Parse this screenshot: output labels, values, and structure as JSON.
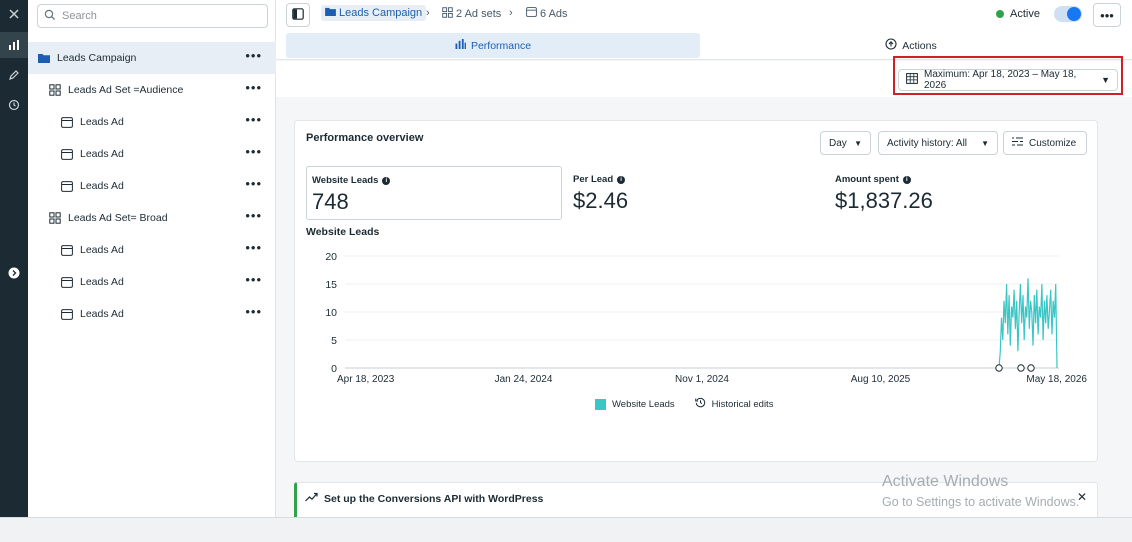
{
  "search": {
    "placeholder": "Search"
  },
  "tree": {
    "items": [
      {
        "label": "Leads Campaign",
        "level": 0,
        "kind": "campaign",
        "selected": true
      },
      {
        "label": "Leads Ad Set =Audience",
        "level": 1,
        "kind": "adset"
      },
      {
        "label": "Leads Ad",
        "level": 2,
        "kind": "ad"
      },
      {
        "label": "Leads Ad",
        "level": 2,
        "kind": "ad"
      },
      {
        "label": "Leads Ad",
        "level": 2,
        "kind": "ad"
      },
      {
        "label": "Leads Ad Set= Broad",
        "level": 1,
        "kind": "adset"
      },
      {
        "label": "Leads Ad",
        "level": 2,
        "kind": "ad"
      },
      {
        "label": "Leads Ad",
        "level": 2,
        "kind": "ad"
      },
      {
        "label": "Leads Ad",
        "level": 2,
        "kind": "ad"
      }
    ],
    "more_glyph": "•••"
  },
  "breadcrumb": {
    "campaign": "Leads Campaign",
    "adsets": "2 Ad sets",
    "ads": "6 Ads"
  },
  "header": {
    "status": "Active",
    "more": "•••"
  },
  "tabs": {
    "performance": "Performance",
    "actions": "Actions"
  },
  "date_range": "Maximum: Apr 18, 2023 – May 18, 2026",
  "overview": {
    "title": "Performance overview",
    "day": "Day",
    "history": "Activity history: All",
    "customize": "Customize",
    "metrics": [
      {
        "label": "Website Leads",
        "value": "748"
      },
      {
        "label": "Per Lead",
        "value": "$2.46"
      },
      {
        "label": "Amount spent",
        "value": "$1,837.26"
      }
    ],
    "chart_title": "Website Leads",
    "legend_leads": "Website Leads",
    "legend_edits": "Historical edits"
  },
  "chart_data": {
    "type": "line",
    "title": "Website Leads",
    "xlabel": "",
    "ylabel": "",
    "ylim": [
      0,
      20
    ],
    "yticks": [
      "20",
      "15",
      "10",
      "5",
      "0"
    ],
    "xticks": [
      "Apr 18, 2023",
      "Jan 24, 2024",
      "Nov 1, 2024",
      "Aug 10, 2025",
      "May 18, 2026"
    ],
    "color": "#3bc6c6",
    "series": [
      {
        "name": "Website Leads",
        "values": [
          0,
          3,
          9,
          5,
          12,
          8,
          15,
          6,
          13,
          4,
          11,
          9,
          14,
          7,
          12,
          3,
          10,
          15,
          8,
          13,
          5,
          11,
          9,
          16,
          7,
          12,
          10,
          4,
          13,
          8,
          14,
          6,
          11,
          9,
          15,
          5,
          12,
          8,
          13,
          7,
          10,
          14,
          6,
          12,
          9,
          15,
          0
        ]
      }
    ]
  },
  "banner": {
    "title": "Set up the Conversions API with WordPress",
    "close": "✕"
  },
  "watermark": {
    "line1": "Activate Windows",
    "line2": "Go to Settings to activate Windows."
  }
}
